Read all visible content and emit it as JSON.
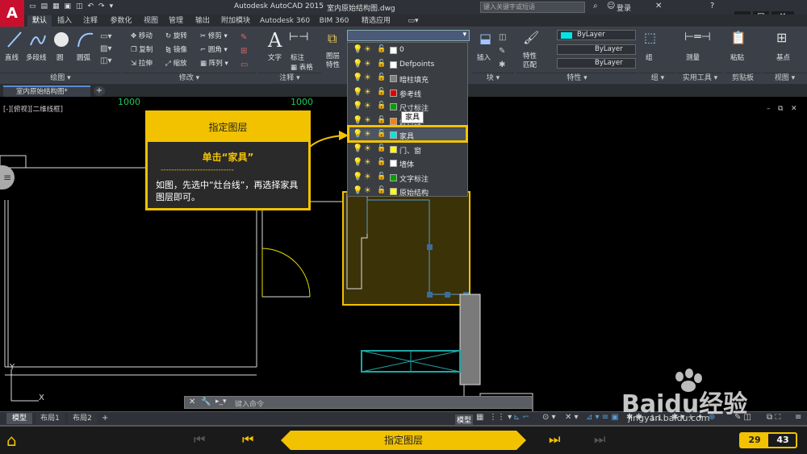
{
  "window": {
    "title": "Autodesk AutoCAD 2015",
    "file": "室内原始结构图.dwg",
    "search_placeholder": "键入关键字或短语",
    "login": "登录"
  },
  "ribbon_tabs": [
    "默认",
    "插入",
    "注释",
    "参数化",
    "视图",
    "管理",
    "输出",
    "附加模块",
    "Autodesk 360",
    "BIM 360",
    "精选应用"
  ],
  "panels": {
    "draw": {
      "label": "绘图",
      "items": [
        "直线",
        "多段线",
        "圆",
        "圆弧"
      ]
    },
    "modify": {
      "label": "修改",
      "items": [
        "移动",
        "旋转",
        "修剪",
        "复制",
        "镜像",
        "圆角",
        "拉伸",
        "缩放",
        "阵列"
      ]
    },
    "annotation": {
      "label": "注释",
      "items": [
        "文字",
        "标注",
        "表格"
      ]
    },
    "layer": {
      "items": [
        "图层特性"
      ]
    },
    "block": {
      "label": "块",
      "items": [
        "插入"
      ]
    },
    "properties": {
      "label": "特性",
      "items": [
        "特性匹配"
      ],
      "color": "ByLayer",
      "linetype": "ByLayer",
      "lineweight": "ByLayer"
    },
    "groups": {
      "label": "组",
      "items": [
        "组"
      ]
    },
    "utilities": {
      "label": "实用工具",
      "items": [
        "测量"
      ]
    },
    "clipboard": {
      "label": "剪贴板",
      "items": [
        "粘贴"
      ]
    },
    "view": {
      "label": "视图",
      "items": [
        "基点"
      ]
    }
  },
  "layers": [
    {
      "name": "0",
      "color": "#ffffff"
    },
    {
      "name": "Defpoints",
      "color": "#ffffff"
    },
    {
      "name": "暗柱填充",
      "color": "#808080"
    },
    {
      "name": "参考线",
      "color": "#e00000"
    },
    {
      "name": "尺寸标注",
      "color": "#00a000"
    },
    {
      "name": "灶台线",
      "color": "#ff8000"
    },
    {
      "name": "家具",
      "color": "#00e5e5"
    },
    {
      "name": "门、窗",
      "color": "#ffff00"
    },
    {
      "name": "墙体",
      "color": "#ffffff"
    },
    {
      "name": "文字标注",
      "color": "#00a000"
    },
    {
      "name": "原始结构",
      "color": "#ffff00"
    }
  ],
  "tooltip": "家具",
  "file_tab": "室内原始结构图*",
  "viewport_label": "[-][俯视][二维线框]",
  "dim_text": [
    "1000",
    "1000"
  ],
  "callout": {
    "title": "指定图层",
    "subtitle": "单击“家具”",
    "divider": "----------------------------",
    "body": "如图，先选中“灶台线”，再选择家具图层即可。"
  },
  "command": {
    "placeholder": "键入命令"
  },
  "layout_tabs": [
    "模型",
    "布局1",
    "布局2"
  ],
  "status": {
    "mode": "模型",
    "scale": "1:1"
  },
  "bottom": {
    "title": "指定图层",
    "current": "29",
    "total": "43",
    "watermark": "Baidu经验",
    "url": "jingyan.baidu.com"
  },
  "colors": {
    "accent": "#f2c200",
    "bg": "#000000",
    "ribbon": "#3b4048"
  }
}
